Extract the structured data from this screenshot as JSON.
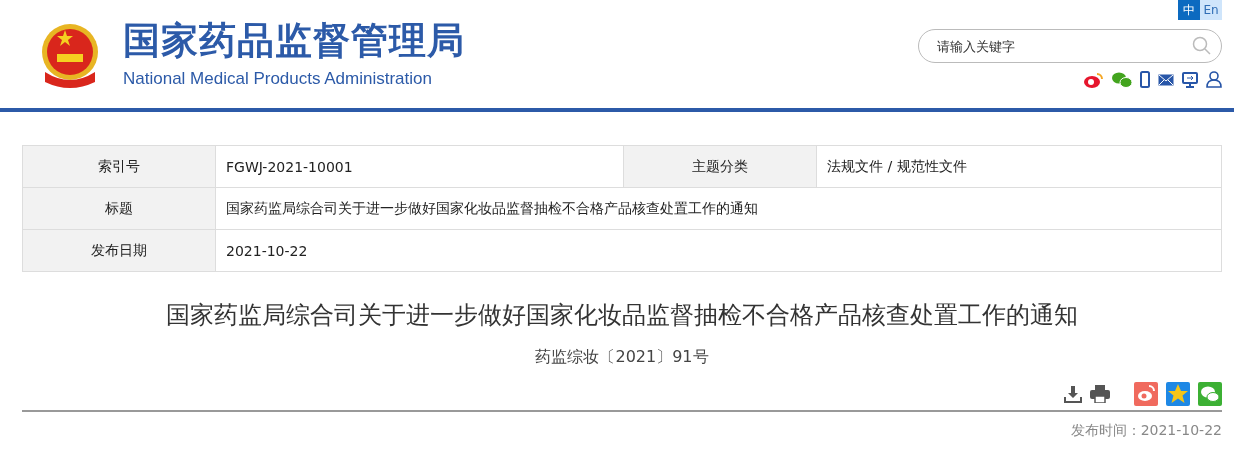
{
  "header": {
    "title": "国家药品监督管理局",
    "subtitle": "National Medical Products Administration"
  },
  "languages": [
    {
      "label": "中",
      "selected": true
    },
    {
      "label": "En",
      "selected": false
    }
  ],
  "search": {
    "placeholder": "请输入关键字"
  },
  "info_table": {
    "rows": [
      {
        "cells": [
          {
            "label": "索引号",
            "value": "FGWJ-2021-10001"
          },
          {
            "label": "主题分类",
            "value": "法规文件 / 规范性文件"
          }
        ]
      },
      {
        "cells": [
          {
            "label": "标题",
            "value": "国家药监局综合司关于进一步做好国家化妆品监督抽检不合格产品核查处置工作的通知"
          }
        ]
      },
      {
        "cells": [
          {
            "label": "发布日期",
            "value": "2021-10-22"
          }
        ]
      }
    ]
  },
  "article": {
    "title": "国家药监局综合司关于进一步做好国家化妆品监督抽检不合格产品核查处置工作的通知",
    "doc_number": "药监综妆〔2021〕91号",
    "published": "发布时间：2021-10-22"
  }
}
